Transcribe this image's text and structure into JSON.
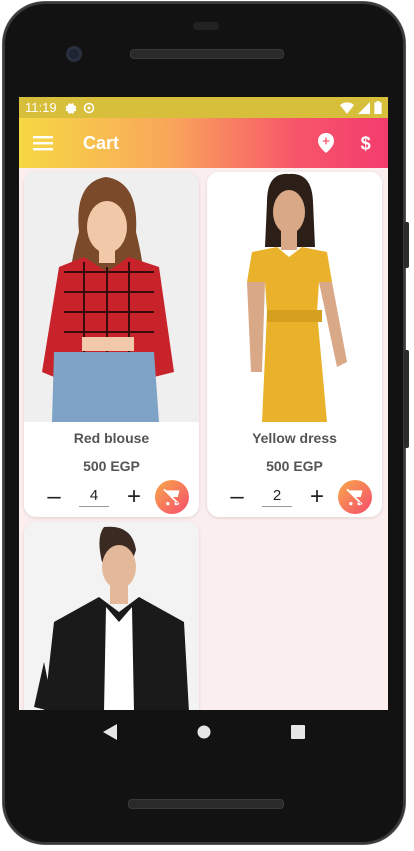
{
  "status": {
    "time": "11:19"
  },
  "appbar": {
    "title": "Cart"
  },
  "products": [
    {
      "name": "Red blouse",
      "price": "500 EGP",
      "qty": "4"
    },
    {
      "name": "Yellow dress",
      "price": "500 EGP",
      "qty": "2"
    },
    {
      "name": "",
      "price": "",
      "qty": ""
    }
  ],
  "qty_controls": {
    "minus": "–",
    "plus": "+"
  },
  "colors": {
    "appbar_start": "#f6d844",
    "appbar_end": "#f33c6e",
    "status_bar": "#d8bf3b",
    "screen_bg": "#fbeeee"
  },
  "icons": [
    "menu-icon",
    "location-pin-icon",
    "dollar-icon",
    "remove-from-cart-icon",
    "back-icon",
    "home-icon",
    "recents-icon"
  ]
}
